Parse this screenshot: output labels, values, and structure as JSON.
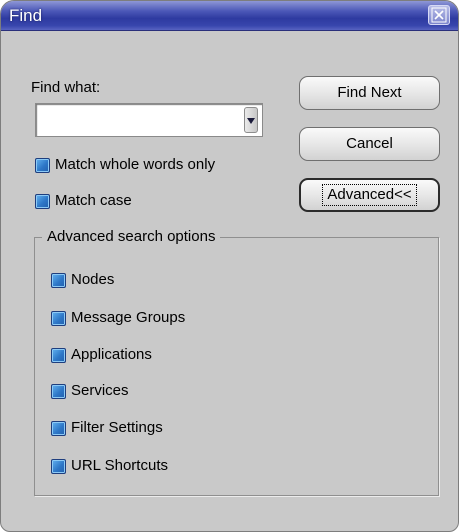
{
  "window": {
    "title": "Find"
  },
  "find": {
    "label": "Find what:",
    "value": ""
  },
  "options": {
    "match_whole_words": "Match whole words only",
    "match_case": "Match case"
  },
  "buttons": {
    "find_next": "Find Next",
    "cancel": "Cancel",
    "advanced": "Advanced<<"
  },
  "advanced": {
    "legend": "Advanced search options",
    "items": [
      {
        "label": "Nodes"
      },
      {
        "label": "Message Groups"
      },
      {
        "label": "Applications"
      },
      {
        "label": "Services"
      },
      {
        "label": "Filter Settings"
      },
      {
        "label": "URL Shortcuts"
      }
    ]
  },
  "colors": {
    "titlebar": "#2e3aa0",
    "dialog_bg": "#c9c9c9",
    "checkbox": "#2e78c8"
  },
  "icons": {
    "close": "close-icon",
    "dropdown": "chevron-down-icon"
  }
}
